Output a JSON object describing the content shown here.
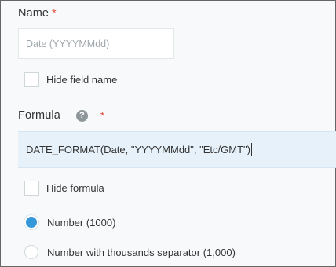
{
  "name_section": {
    "label": "Name",
    "required_mark": "*",
    "input_placeholder": "Date (YYYYMMdd)",
    "hide_label": "Hide field name"
  },
  "formula_section": {
    "label": "Formula",
    "help_icon": "?",
    "required_mark": "*",
    "value": "DATE_FORMAT(Date, \"YYYYMMdd\", \"Etc/GMT\")",
    "hide_label": "Hide formula"
  },
  "format_options": [
    {
      "label": "Number (1000)",
      "selected": true
    },
    {
      "label": "Number with thousands separator (1,000)",
      "selected": false
    }
  ],
  "colors": {
    "accent": "#3498db",
    "required": "#e74c3c",
    "formula_background": "#e6f1fa"
  }
}
